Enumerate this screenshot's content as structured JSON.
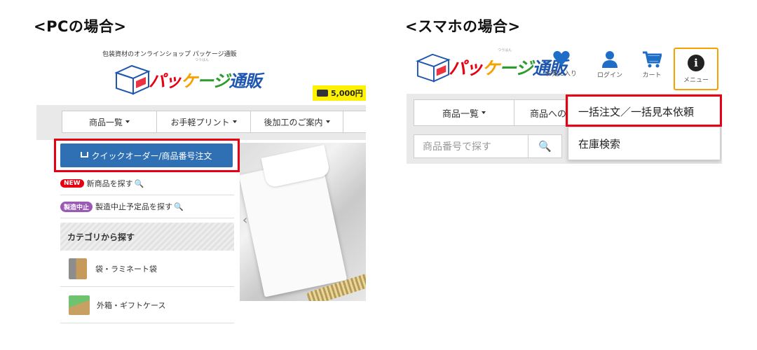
{
  "titles": {
    "pc": "<PCの場合>",
    "smartphone": "<スマホの場合>"
  },
  "brand": {
    "tagline": "包装資材のオンラインショップ パッケージ通販",
    "logo_part1": "パッ",
    "logo_part2": "ケ",
    "logo_part3": "ージ",
    "logo_part4": "通販",
    "logo_ruby": "つうはん"
  },
  "pc": {
    "shipping_badge": "5,000円",
    "nav": [
      {
        "label": "商品一覧"
      },
      {
        "label": "お手軽プリント"
      },
      {
        "label": "後加工のご案内"
      }
    ],
    "quick_order_button": "クイックオーダー/商品番号注文",
    "new_badge": "NEW",
    "new_products_link": "新商品を探す",
    "discontinued_badge": "製造中止",
    "discontinued_link": "製造中止予定品を探す",
    "search_glyph": "🔍",
    "category_header": "カテゴリから探す",
    "categories": [
      {
        "label": "袋・ラミネート袋"
      },
      {
        "label": "外箱・ギフトケース"
      }
    ],
    "carousel_arrow": "‹"
  },
  "smartphone": {
    "icons": [
      {
        "name": "heart-icon",
        "label": "お気に入り"
      },
      {
        "name": "user-icon",
        "label": "ログイン"
      },
      {
        "name": "cart-icon",
        "label": "カート"
      }
    ],
    "menu_label": "メニュー",
    "menu_glyph": "i",
    "category_button": "商品一覧",
    "second_button": "商品への",
    "search_placeholder": "商品番号で探す",
    "search_glyph": "🔍",
    "dropdown": [
      {
        "label": "一括注文／一括見本依頼"
      },
      {
        "label": "在庫検索"
      }
    ]
  },
  "colors": {
    "highlight": "#e60012",
    "primary_button": "#2f6fb4",
    "menu_border": "#f6a100",
    "icon_blue": "#1e6ec8"
  }
}
